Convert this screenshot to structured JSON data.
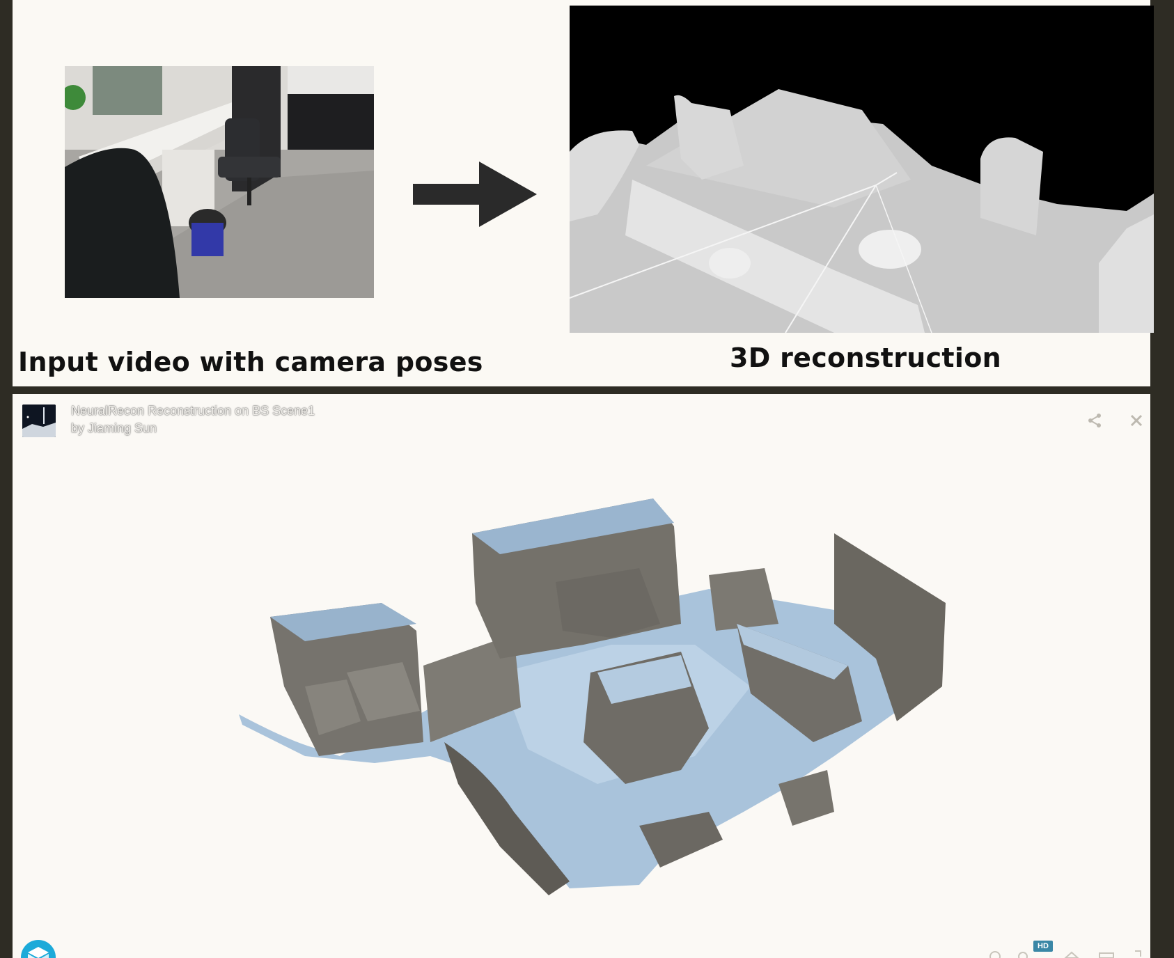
{
  "figure": {
    "caption_left": "Input video with camera poses",
    "caption_right": "3D reconstruction"
  },
  "viewer": {
    "title": "NeuralRecon Reconstruction on BS Scene1",
    "author_prefix": "by",
    "author": "Jiaming Sun",
    "hd_label": "HD",
    "icons": {
      "share": "share-icon",
      "close": "close-icon",
      "logo": "sketchfab-logo-icon",
      "help": "help-icon",
      "settings": "settings-icon",
      "vr": "vr-icon",
      "fullscreen": "fullscreen-icon"
    }
  },
  "colors": {
    "page_bg": "#2e2c24",
    "panel_bg": "#fbf9f4",
    "mesh_blue": "#a9c3db",
    "mesh_wall": "#6e6b64",
    "accent": "#1caad9"
  }
}
